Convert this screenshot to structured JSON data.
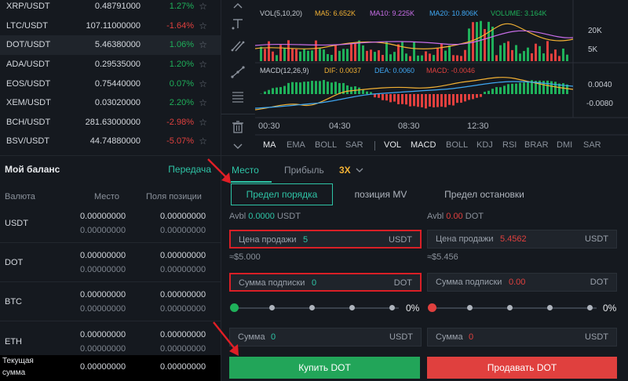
{
  "tickers": [
    {
      "pair": "XRP/USDT",
      "price": "0.48791000",
      "change": "1.27%",
      "dir": "up"
    },
    {
      "pair": "LTC/USDT",
      "price": "107.11000000",
      "change": "-1.64%",
      "dir": "down"
    },
    {
      "pair": "DOT/USDT",
      "price": "5.46380000",
      "change": "1.06%",
      "dir": "up"
    },
    {
      "pair": "ADA/USDT",
      "price": "0.29535000",
      "change": "1.20%",
      "dir": "up"
    },
    {
      "pair": "EOS/USDT",
      "price": "0.75440000",
      "change": "0.07%",
      "dir": "up"
    },
    {
      "pair": "XEM/USDT",
      "price": "0.03020000",
      "change": "2.20%",
      "dir": "up"
    },
    {
      "pair": "BCH/USDT",
      "price": "281.63000000",
      "change": "-2.98%",
      "dir": "down"
    },
    {
      "pair": "BSV/USDT",
      "price": "44.74880000",
      "change": "-5.07%",
      "dir": "down"
    }
  ],
  "star_glyph": "☆",
  "chart": {
    "vol_legend": {
      "label": "VOL(5,10,20)",
      "ma5": "MA5: 6.652K",
      "ma10": "MA10: 9.225K",
      "ma20": "MA20: 10.806K",
      "volume": "VOLUME: 3.164K"
    },
    "vol_axis": [
      "20K",
      "5K"
    ],
    "macd_legend": {
      "label": "MACD(12,26,9)",
      "dif": "DIF: 0.0037",
      "dea": "DEA: 0.0060",
      "macd": "MACD: -0.0046"
    },
    "macd_axis": [
      "0.0040",
      "-0.0080"
    ],
    "times": [
      "00:30",
      "04:30",
      "08:30",
      "12:30"
    ],
    "indicators_main": [
      "MA",
      "EMA",
      "BOLL",
      "SAR"
    ],
    "indicators_sub": [
      "VOL",
      "MACD",
      "BOLL",
      "KDJ",
      "RSI",
      "BRAR",
      "DMI",
      "SAR"
    ],
    "colors": {
      "up": "#1fb05a",
      "down": "#e0403e",
      "ma5": "#f2b134",
      "ma10": "#c86ee8",
      "ma20": "#3fa8f4",
      "volume": "#1fb05a"
    }
  },
  "balance": {
    "title": "Мой баланс",
    "transfer": "Передача",
    "headers": {
      "currency": "Валюта",
      "place": "Место",
      "position": "Поля позиции"
    },
    "rows": [
      {
        "currency": "USDT",
        "place": "0.00000000",
        "place_sub": "0.00000000",
        "pos": "0.00000000",
        "pos_sub": "0.00000000"
      },
      {
        "currency": "DOT",
        "place": "0.00000000",
        "place_sub": "0.00000000",
        "pos": "0.00000000",
        "pos_sub": "0.00000000"
      },
      {
        "currency": "BTC",
        "place": "0.00000000",
        "place_sub": "0.00000000",
        "pos": "0.00000000",
        "pos_sub": "0.00000000"
      },
      {
        "currency": "ETH",
        "place": "0.00000000",
        "place_sub": "0.00000000",
        "pos": "0.00000000",
        "pos_sub": "0.00000000"
      }
    ],
    "total_label_1": "Текущая",
    "total_label_2": "сумма",
    "total_place": "0.00000000",
    "total_pos": "0.00000000"
  },
  "order": {
    "tabs": {
      "spot": "Место",
      "profit": "Прибыль",
      "leverage": "3X"
    },
    "subtabs": [
      "Предел порядка",
      "позиция MV",
      "Предел остановки"
    ],
    "buy": {
      "avbl_label": "Avbl",
      "avbl_value": "0.0000",
      "avbl_unit": "USDT",
      "price_label": "Цена продажи",
      "price_value": "5",
      "price_unit": "USDT",
      "approx": "≈$5.000",
      "amount_label": "Сумма подписки",
      "amount_value": "0",
      "amount_unit": "DOT",
      "percent": "0%",
      "total_label": "Сумма",
      "total_value": "0",
      "total_unit": "USDT",
      "button": "Купить DOT"
    },
    "sell": {
      "avbl_label": "Avbl",
      "avbl_value": "0.00",
      "avbl_unit": "DOT",
      "price_label": "Цена продажи",
      "price_value": "5.4562",
      "price_unit": "USDT",
      "approx": "≈$5.456",
      "amount_label": "Сумма подписки",
      "amount_value": "0.00",
      "amount_unit": "DOT",
      "percent": "0%",
      "total_label": "Сумма",
      "total_value": "0",
      "total_unit": "USDT",
      "button": "Продавать DOT"
    },
    "colors": {
      "accent": "#2ec4a6",
      "buy": "#22a559",
      "sell": "#e0403e"
    }
  }
}
